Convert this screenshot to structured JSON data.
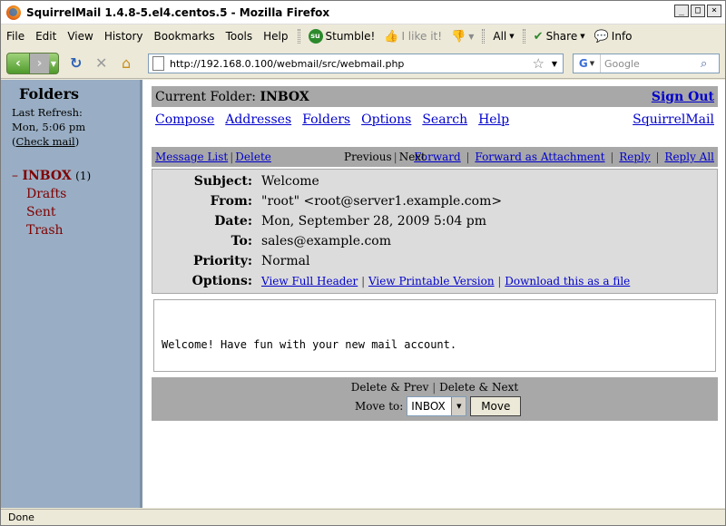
{
  "window": {
    "title": "SquirrelMail 1.4.8-5.el4.centos.5 - Mozilla Firefox"
  },
  "menu": {
    "items": [
      "File",
      "Edit",
      "View",
      "History",
      "Bookmarks",
      "Tools",
      "Help"
    ],
    "toolbar": {
      "stumble": "Stumble!",
      "ilike": "I like it!",
      "all": "All",
      "share": "Share",
      "info": "Info"
    }
  },
  "nav": {
    "url": "http://192.168.0.100/webmail/src/webmail.php",
    "search_placeholder": "Google"
  },
  "sidebar": {
    "heading": "Folders",
    "last_refresh_label": "Last Refresh:",
    "last_refresh_time": "Mon, 5:06 pm",
    "check_mail": "Check mail",
    "collapse": "–",
    "inbox": "INBOX",
    "inbox_count": "(1)",
    "folders": [
      "Drafts",
      "Sent",
      "Trash"
    ]
  },
  "main": {
    "current_folder_label": "Current Folder:",
    "current_folder": "INBOX",
    "sign_out": "Sign Out",
    "links": [
      "Compose",
      "Addresses",
      "Folders",
      "Options",
      "Search",
      "Help"
    ],
    "brand": "SquirrelMail",
    "msgbar": {
      "message_list": "Message List",
      "delete": "Delete",
      "previous": "Previous",
      "next": "Next",
      "forward": "Forward",
      "forward_attachment": "Forward as Attachment",
      "reply": "Reply",
      "reply_all": "Reply All"
    },
    "headers": {
      "subject_label": "Subject:",
      "subject": "Welcome",
      "from_label": "From:",
      "from": "\"root\" <root@server1.example.com>",
      "date_label": "Date:",
      "date": "Mon, September 28, 2009 5:04 pm",
      "to_label": "To:",
      "to": "sales@example.com",
      "priority_label": "Priority:",
      "priority": "Normal",
      "options_label": "Options:",
      "view_full_header": "View Full Header",
      "view_printable": "View Printable Version",
      "download": "Download this as a file"
    },
    "body": "Welcome! Have fun with your new mail account.",
    "bottom": {
      "delete_prev": "Delete & Prev",
      "delete_next": "Delete & Next",
      "move_to_label": "Move to:",
      "move_to_value": "INBOX",
      "move_button": "Move"
    }
  },
  "status": {
    "text": "Done"
  }
}
